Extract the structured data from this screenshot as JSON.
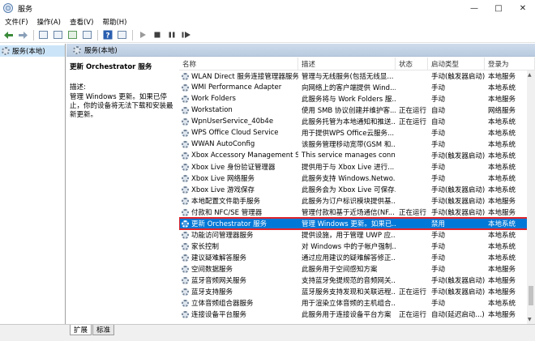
{
  "window": {
    "title": "服务"
  },
  "menu": [
    "文件(F)",
    "操作(A)",
    "查看(V)",
    "帮助(H)"
  ],
  "tree": {
    "root_label": "服务(本地)"
  },
  "header": {
    "label": "服务(本地)"
  },
  "detail": {
    "title": "更新 Orchestrator 服务",
    "desc_label": "描述:",
    "desc_text": "管理 Windows 更新。如果已停止，你的设备将无法下载和安装最新更新。"
  },
  "columns": [
    "名称",
    "描述",
    "状态",
    "启动类型",
    "登录为"
  ],
  "rows": [
    {
      "name": "WLAN Direct 服务连接管理器服务",
      "desc": "管理与无线服务(包括无线显...",
      "status": "",
      "start": "手动(触发器启动)",
      "logon": "本地服务"
    },
    {
      "name": "WMI Performance Adapter",
      "desc": "向网络上的客户端提供 Wind...",
      "status": "",
      "start": "手动",
      "logon": "本地系统"
    },
    {
      "name": "Work Folders",
      "desc": "此服务将与 Work Folders 服...",
      "status": "",
      "start": "手动",
      "logon": "本地服务"
    },
    {
      "name": "Workstation",
      "desc": "使用 SMB 协议创建并维护客...",
      "status": "正在运行",
      "start": "自动",
      "logon": "网络服务"
    },
    {
      "name": "WpnUserService_40b4e",
      "desc": "此服务托管为本地通知和推送...",
      "status": "正在运行",
      "start": "自动",
      "logon": "本地系统"
    },
    {
      "name": "WPS Office Cloud Service",
      "desc": "用于提供WPS Office云服务...",
      "status": "",
      "start": "手动",
      "logon": "本地系统"
    },
    {
      "name": "WWAN AutoConfig",
      "desc": "该服务管理移动宽带(GSM 和...",
      "status": "",
      "start": "手动",
      "logon": "本地系统"
    },
    {
      "name": "Xbox Accessory Management S...",
      "desc": "This service manages conn...",
      "status": "",
      "start": "手动(触发器启动)",
      "logon": "本地系统"
    },
    {
      "name": "Xbox Live 身份验证管理器",
      "desc": "提供用于与 Xbox Live 进行...",
      "status": "",
      "start": "手动",
      "logon": "本地系统"
    },
    {
      "name": "Xbox Live 网络服务",
      "desc": "此服务支持 Windows.Netwo...",
      "status": "",
      "start": "手动",
      "logon": "本地系统"
    },
    {
      "name": "Xbox Live 游戏保存",
      "desc": "此服务会为 Xbox Live 可保存...",
      "status": "",
      "start": "手动(触发器启动)",
      "logon": "本地系统"
    },
    {
      "name": "本地配置文件助手服务",
      "desc": "此服务为订户标识模块提供基...",
      "status": "",
      "start": "手动(触发器启动)",
      "logon": "本地服务"
    },
    {
      "name": "付款和 NFC/SE 管理器",
      "desc": "管理付款和基于近场通信(NF...",
      "status": "正在运行",
      "start": "手动(触发器启动)",
      "logon": "本地服务"
    },
    {
      "name": "更新 Orchestrator 服务",
      "desc": "管理 Windows 更新。如果已...",
      "status": "",
      "start": "禁用",
      "logon": "本地系统",
      "selected": true
    },
    {
      "name": "功能访问管理器服务",
      "desc": "提供设施，用于管理 UWP 应...",
      "status": "",
      "start": "手动",
      "logon": "本地系统"
    },
    {
      "name": "家长控制",
      "desc": "对 Windows 中的子帐户强制...",
      "status": "",
      "start": "手动",
      "logon": "本地系统"
    },
    {
      "name": "建议疑难解答服务",
      "desc": "通过应用建议的疑难解答修正...",
      "status": "",
      "start": "手动",
      "logon": "本地系统"
    },
    {
      "name": "空间数据服务",
      "desc": "此服务用于空间感知方案",
      "status": "",
      "start": "手动",
      "logon": "本地服务"
    },
    {
      "name": "蓝牙音频网关服务",
      "desc": "支持蓝牙免提规范的音频网关...",
      "status": "",
      "start": "手动(触发器启动)",
      "logon": "本地服务"
    },
    {
      "name": "蓝牙支持服务",
      "desc": "蓝牙服务支持发现和关联远程...",
      "status": "正在运行",
      "start": "手动(触发器启动)",
      "logon": "本地服务"
    },
    {
      "name": "立体音频组合器服务",
      "desc": "用于渲染立体音频的主机组合...",
      "status": "",
      "start": "手动",
      "logon": "本地系统"
    },
    {
      "name": "连接设备平台服务",
      "desc": "此服务用于连接设备平台方案",
      "status": "正在运行",
      "start": "自动(延迟启动...)",
      "logon": "本地服务"
    }
  ],
  "tabs": [
    "扩展",
    "标准"
  ]
}
